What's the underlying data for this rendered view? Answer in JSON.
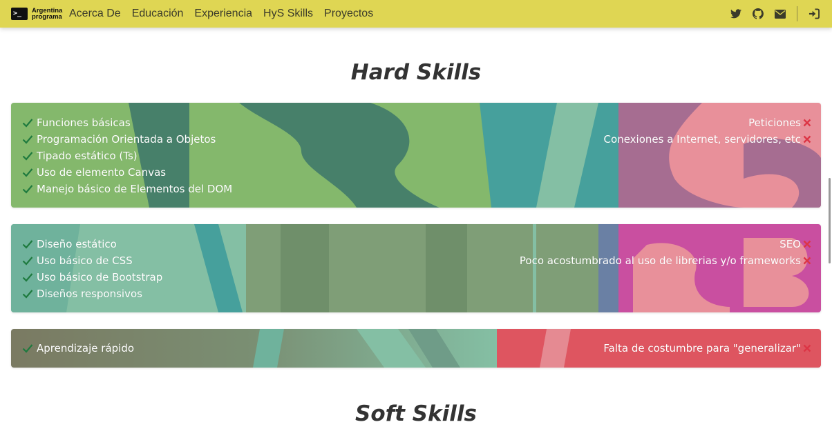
{
  "nav": {
    "logo_prompt": ">_",
    "logo_line1": "Argentina",
    "logo_line2": "programa",
    "links": [
      "Acerca De",
      "Educación",
      "Experiencia",
      "HyS Skills",
      "Proyectos"
    ],
    "icons": [
      "twitter-icon",
      "github-icon",
      "envelope-icon",
      "sign-in-icon"
    ]
  },
  "hard_skills": {
    "title": "Hard Skills",
    "cards": [
      {
        "strengths": [
          "Funciones básicas",
          "Programación Orientada a Objetos",
          "Tipado estático (Ts)",
          "Uso de elemento Canvas",
          "Manejo básico de Elementos del DOM"
        ],
        "weaknesses": [
          "Peticiones",
          "Conexiones a Internet, servidores, etc"
        ]
      },
      {
        "strengths": [
          "Diseño estático",
          "Uso básico de CSS",
          "Uso básico de Bootstrap",
          "Diseños responsivos"
        ],
        "weaknesses": [
          "SEO",
          "Poco acostumbrado al uso de librerias y/o frameworks"
        ]
      },
      {
        "strengths": [
          "Aprendizaje rápido"
        ],
        "weaknesses": [
          "Falta de costumbre para \"generalizar\""
        ]
      }
    ]
  },
  "soft_skills": {
    "title": "Soft Skills"
  },
  "colors": {
    "navbar": "#dfd653",
    "check": "#1e7a3e",
    "cross": "#dc3545",
    "green": "#84b86c",
    "teal": "#46a09c",
    "pink": "#e8909a",
    "magenta": "#c94fa0",
    "red": "#de5560"
  }
}
